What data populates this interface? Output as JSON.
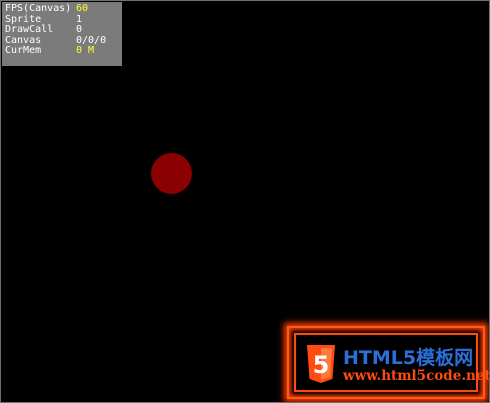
{
  "stats": [
    {
      "label": "FPS(Canvas)",
      "value": "60",
      "highlight": true
    },
    {
      "label": "Sprite",
      "value": "1",
      "highlight": false
    },
    {
      "label": "DrawCall",
      "value": "0",
      "highlight": false
    },
    {
      "label": "Canvas",
      "value": "0/0/0",
      "highlight": false
    },
    {
      "label": "CurMem",
      "value": "0 M",
      "highlight": true
    }
  ],
  "watermark": {
    "title": "HTML5模板网",
    "url": "www.html5code.net",
    "badge_text": "5"
  },
  "colors": {
    "background": "#000000",
    "ball": "#8b0000",
    "stats_panel": "#7b7b7b",
    "stats_highlight": "#ffff33",
    "brand_orange": "#ff4a10",
    "brand_blue": "#2b6fd8"
  }
}
